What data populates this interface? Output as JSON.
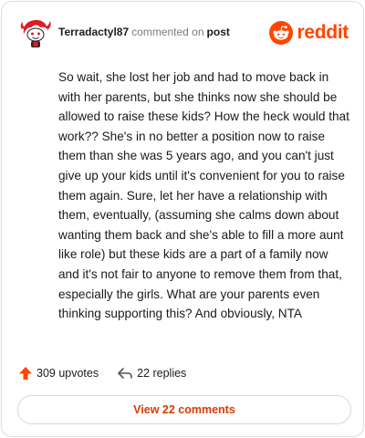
{
  "comment": {
    "username": "Terradactyl87",
    "action_text": "commented on",
    "post_link": "post",
    "body": "So wait, she lost her job and had to move back in with her parents, but she thinks now she should be allowed to raise these kids? How the heck would that work?? She's in no better a position now to raise them than she was 5 years ago, and you can't just give up your kids until it's convenient for you to raise them again. Sure, let her have a relationship with them, eventually, (assuming she calms down about wanting them back and she's able to fill a more aunt like role) but these kids are a part of a family now and it's not fair to anyone to remove them from that, especially the girls. What are your parents even thinking supporting this? And obviously, NTA"
  },
  "brand": {
    "name": "reddit",
    "icon": "reddit-snoo-icon",
    "color": "#ff4500"
  },
  "stats": {
    "upvotes": "309 upvotes",
    "replies": "22 replies",
    "upvote_color": "#ff4500"
  },
  "actions": {
    "view_comments_label": "View 22 comments"
  }
}
